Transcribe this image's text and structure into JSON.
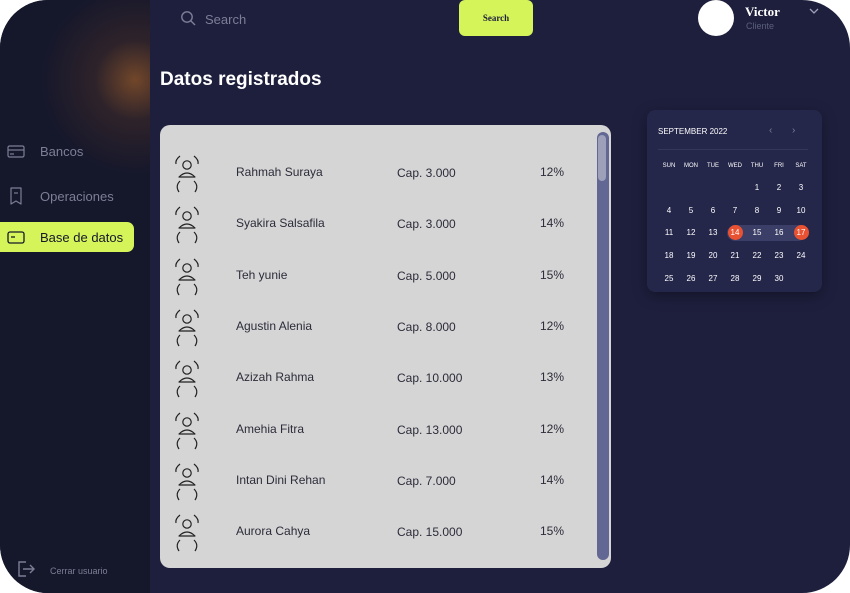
{
  "search": {
    "placeholder": "Search",
    "button_label": "Search"
  },
  "user": {
    "name": "Victor",
    "role": "Cliente"
  },
  "sidebar": {
    "items": [
      {
        "label": "Bancos",
        "icon": "bank-card-icon",
        "active": false
      },
      {
        "label": "Operaciones",
        "icon": "receipt-icon",
        "active": false
      },
      {
        "label": "Base de datos",
        "icon": "database-card-icon",
        "active": true
      }
    ],
    "logout_label": "Cerrar usuario"
  },
  "main": {
    "title": "Datos registrados",
    "rows": [
      {
        "name": "Rahmah Suraya",
        "cap": "Cap. 3.000",
        "pct": "12%"
      },
      {
        "name": "Syakira Salsafila",
        "cap": "Cap. 3.000",
        "pct": "14%"
      },
      {
        "name": "Teh yunie",
        "cap": "Cap. 5.000",
        "pct": "15%"
      },
      {
        "name": "Agustin Alenia",
        "cap": "Cap. 8.000",
        "pct": "12%"
      },
      {
        "name": "Azizah Rahma",
        "cap": "Cap. 10.000",
        "pct": "13%"
      },
      {
        "name": "Amehia Fitra",
        "cap": "Cap. 13.000",
        "pct": "12%"
      },
      {
        "name": "Intan Dini Rehan",
        "cap": "Cap. 7.000",
        "pct": "14%"
      },
      {
        "name": "Aurora Cahya",
        "cap": "Cap. 15.000",
        "pct": "15%"
      }
    ]
  },
  "calendar": {
    "title": "SEPTEMBER 2022",
    "prev": "‹",
    "next": "›",
    "weekdays": [
      "SUN",
      "MON",
      "TUE",
      "WED",
      "THU",
      "FRI",
      "SAT"
    ],
    "weeks": [
      [
        "",
        "",
        "",
        "",
        "1",
        "2",
        "3"
      ],
      [
        "4",
        "5",
        "6",
        "7",
        "8",
        "9",
        "10"
      ],
      [
        "11",
        "12",
        "13",
        "14",
        "15",
        "16",
        "17"
      ],
      [
        "18",
        "19",
        "20",
        "21",
        "22",
        "23",
        "24"
      ],
      [
        "25",
        "26",
        "27",
        "28",
        "29",
        "30",
        ""
      ]
    ],
    "selected_start": "14",
    "selected_end": "17"
  },
  "colors": {
    "accent": "#d4f45a",
    "background": "#1e1f3d",
    "sidebar": "#15172b",
    "selected_day": "#e85232",
    "table_bg": "#d5d5d5"
  }
}
